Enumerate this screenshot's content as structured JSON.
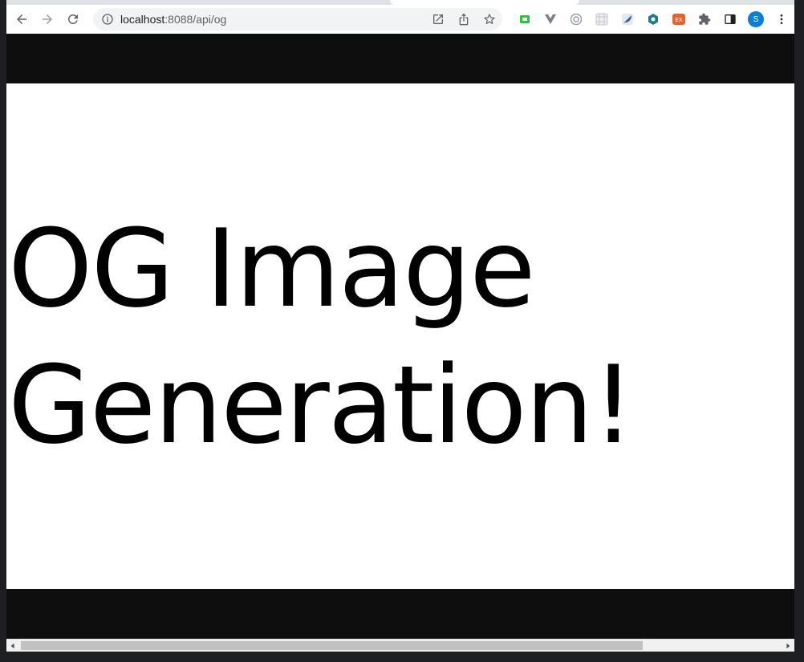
{
  "browser": {
    "url_host": "localhost",
    "url_path": ":8088/api/og",
    "profile_initial": "S",
    "icons": {
      "back": "arrow-left-icon",
      "forward": "arrow-right-icon",
      "reload": "reload-icon",
      "site_info": "info-icon",
      "open_in_app": "open-external-icon",
      "share": "share-icon",
      "bookmark": "star-icon",
      "extensions_menu": "puzzle-icon",
      "side_panel": "side-panel-icon",
      "menu": "kebab-menu-icon"
    },
    "extensions": [
      {
        "name": "screen-capture-extension-icon",
        "color": "#2fbf3f"
      },
      {
        "name": "vue-devtools-extension-icon",
        "color": "#7a7f87"
      },
      {
        "name": "target-extension-icon",
        "color": "#9aa0a6"
      },
      {
        "name": "grid-extension-icon",
        "color": "#c4c7cc"
      },
      {
        "name": "feather-extension-icon",
        "color": "#3a5a8c"
      },
      {
        "name": "hex-extension-icon",
        "color": "#1f7a8c"
      },
      {
        "name": "ex-extension-icon",
        "color": "#e8602c",
        "label": "EX"
      }
    ]
  },
  "page": {
    "heading": "OG Image Generation!",
    "canvas_background": "#ffffff",
    "page_background": "#0e0e0e",
    "text_color": "#000000"
  },
  "colors": {
    "accent_avatar": "#0b7fd1"
  }
}
